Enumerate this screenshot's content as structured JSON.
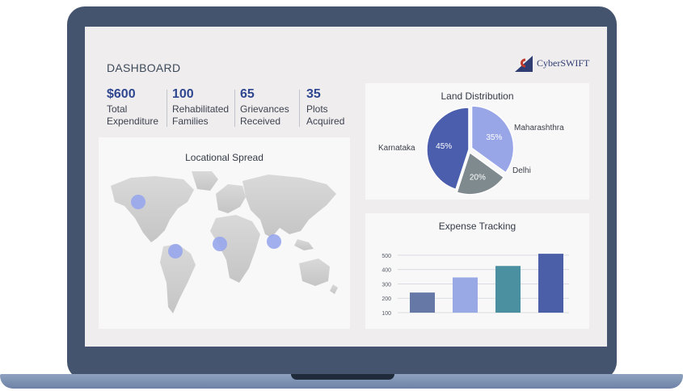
{
  "dashboard": {
    "title": "DASHBOARD"
  },
  "brand": {
    "name": "CyberSWIFT",
    "icon": "cyberswift-logo-icon",
    "color": "#2f3d73",
    "accent": "#c0392b"
  },
  "kpis": [
    {
      "value": "$600",
      "label_line1": "Total",
      "label_line2": "Expenditure"
    },
    {
      "value": "100",
      "label_line1": "Rehabilitated",
      "label_line2": "Families"
    },
    {
      "value": "65",
      "label_line1": "Grievances",
      "label_line2": "Received"
    },
    {
      "value": "35",
      "label_line1": "Plots",
      "label_line2": "Acquired"
    }
  ],
  "map": {
    "title": "Locational Spread",
    "marker_color": "#98a6ec",
    "markers": [
      "north-america",
      "south-america",
      "africa",
      "india"
    ]
  },
  "land_distribution": {
    "title": "Land Distribution",
    "chart_data": {
      "type": "pie",
      "title": "Land Distribution",
      "slices": [
        {
          "label": "Maharashthra",
          "value": 35,
          "value_label": "35%",
          "color": "#98a6e8"
        },
        {
          "label": "Delhi",
          "value": 20,
          "value_label": "20%",
          "color": "#7f8a8f"
        },
        {
          "label": "Karnataka",
          "value": 45,
          "value_label": "45%",
          "color": "#4b5ead"
        }
      ]
    }
  },
  "expense_tracking": {
    "title": "Expense Tracking",
    "chart_data": {
      "type": "bar",
      "title": "Expense Tracking",
      "categories": [
        "",
        "",
        "",
        ""
      ],
      "values": [
        240,
        345,
        425,
        510
      ],
      "colors": [
        "#6678a6",
        "#98a9e6",
        "#4b90a0",
        "#4b5ea8"
      ],
      "yticks": [
        100,
        200,
        300,
        400,
        500
      ],
      "ytick_labels": [
        "100",
        "200",
        "300",
        "400",
        "500"
      ],
      "ylim": [
        100,
        550
      ],
      "grid": true
    }
  }
}
